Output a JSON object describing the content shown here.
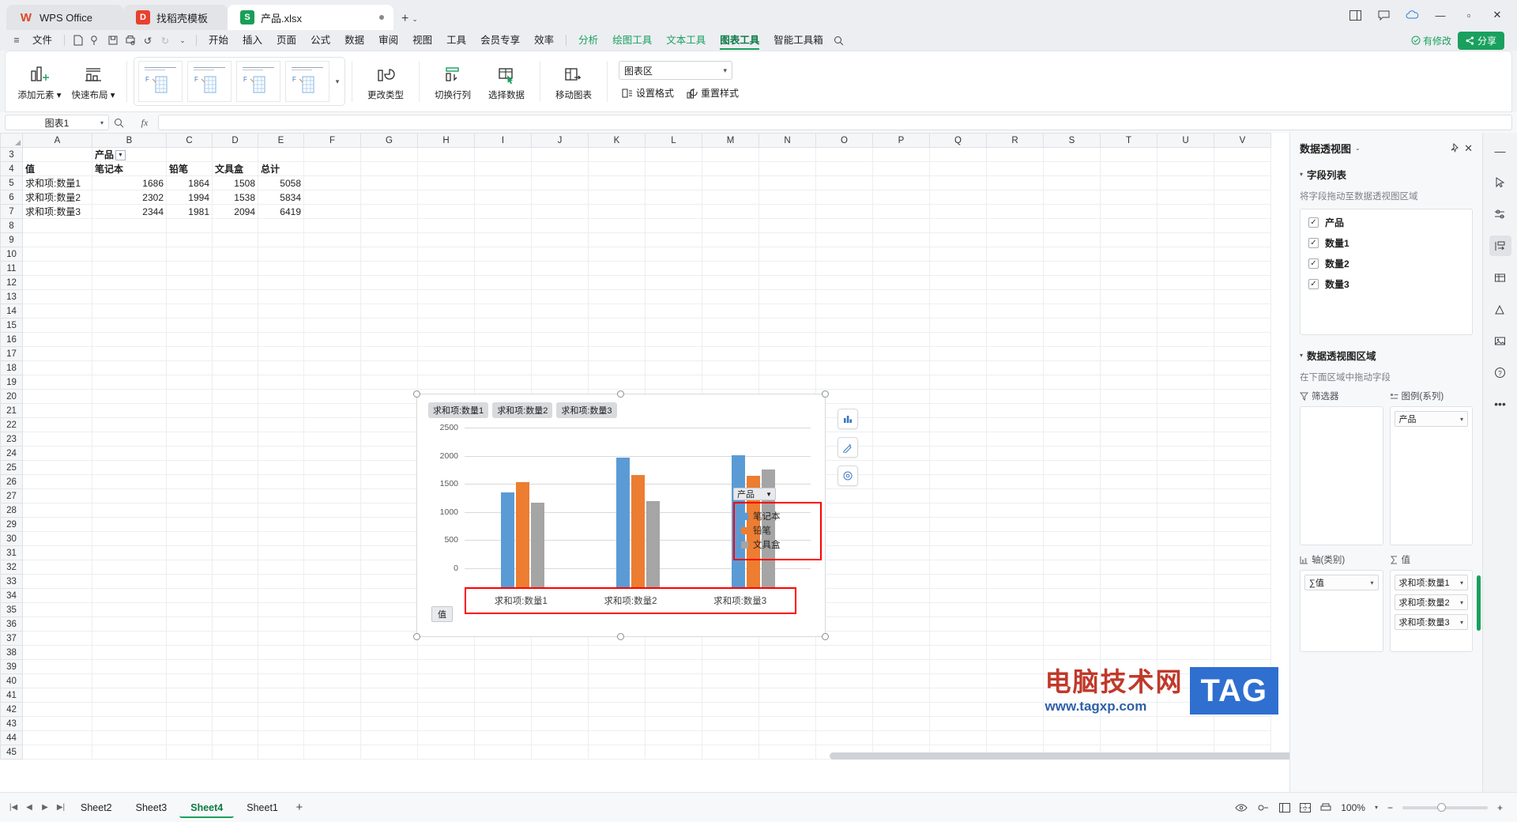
{
  "titlebar": {
    "tabs": [
      {
        "label": "WPS Office",
        "icon": "wps-logo-icon"
      },
      {
        "label": "找稻壳模板",
        "icon": "template-icon"
      },
      {
        "label": "产品.xlsx",
        "icon": "excel-file-icon"
      }
    ],
    "new_tab": "+",
    "new_tab_chevron": "⌄",
    "window_buttons": [
      "⊟",
      "🗗",
      "—",
      "▫",
      "✕"
    ]
  },
  "menubar": {
    "file_label": "文件",
    "items": [
      "开始",
      "插入",
      "页面",
      "公式",
      "数据",
      "审阅",
      "视图",
      "工具",
      "会员专享",
      "效率"
    ],
    "green_items": [
      "分析",
      "绘图工具",
      "文本工具"
    ],
    "active_item": "图表工具",
    "trailing_items": [
      "智能工具箱"
    ],
    "search_icon": "search-icon",
    "saved_label": "有修改",
    "share_label": "分享"
  },
  "ribbon": {
    "buttons": [
      {
        "label": "添加元素",
        "icon": "add-chart-element-icon",
        "dropdown": true
      },
      {
        "label": "快速布局",
        "icon": "quick-layout-icon",
        "dropdown": true
      }
    ],
    "gallery_more": "▾",
    "tools": [
      {
        "label": "更改类型",
        "icon": "change-chart-type-icon"
      },
      {
        "label": "切换行列",
        "icon": "switch-row-column-icon"
      },
      {
        "label": "选择数据",
        "icon": "select-data-icon"
      },
      {
        "label": "移动图表",
        "icon": "move-chart-icon"
      }
    ],
    "chart_area_select": "图表区",
    "format_label": "设置格式",
    "reset_label": "重置样式"
  },
  "formulabar": {
    "namebox": "图表1",
    "fx_label": "fx",
    "zoom_icon": "search-zoom-icon",
    "value": ""
  },
  "sheet": {
    "columns": [
      "A",
      "B",
      "C",
      "D",
      "E",
      "F",
      "G",
      "H",
      "I",
      "J",
      "K",
      "L",
      "M",
      "N",
      "O",
      "P",
      "Q",
      "R",
      "S",
      "T",
      "U",
      "V"
    ],
    "rows": [
      3,
      4,
      5,
      6,
      7,
      8,
      9,
      10,
      11,
      12,
      13,
      14,
      15,
      16,
      17,
      18,
      19,
      20,
      21,
      22,
      23,
      24,
      25,
      26,
      27,
      28,
      29,
      30,
      31,
      32,
      33,
      34,
      35,
      36,
      37,
      38,
      39,
      40,
      41,
      42,
      43,
      44,
      45
    ],
    "cells": {
      "B3": "产品",
      "A4": "值",
      "B4": "笔记本",
      "C4": "铅笔",
      "D4": "文具盒",
      "E4": "总计",
      "A5": "求和项:数量1",
      "B5": "1686",
      "C5": "1864",
      "D5": "1508",
      "E5": "5058",
      "A6": "求和项:数量2",
      "B6": "2302",
      "C6": "1994",
      "D6": "1538",
      "E6": "5834",
      "A7": "求和项:数量3",
      "B7": "2344",
      "C7": "1981",
      "D7": "2094",
      "E7": "6419"
    },
    "filter_glyph": "▼"
  },
  "chart_data": {
    "type": "bar",
    "title": "",
    "series_buttons": [
      "求和项:数量1",
      "求和项:数量2",
      "求和项:数量3"
    ],
    "categories": [
      "求和项:数量1",
      "求和项:数量2",
      "求和项:数量3"
    ],
    "series": [
      {
        "name": "笔记本",
        "color": "#5b9bd5",
        "values": [
          1686,
          2302,
          2344
        ]
      },
      {
        "name": "铅笔",
        "color": "#ed7d31",
        "values": [
          1864,
          1994,
          1981
        ]
      },
      {
        "name": "文具盒",
        "color": "#a5a5a5",
        "values": [
          1508,
          1538,
          2094
        ]
      }
    ],
    "yticks": [
      2500,
      2000,
      1500,
      1000,
      500,
      0
    ],
    "ylim": [
      0,
      2500
    ],
    "xlabel": "",
    "ylabel": "",
    "grid": true,
    "legend_position": "right",
    "legend_filter_label": "产品",
    "value_button": "值",
    "highlight_color": "#ff0000"
  },
  "chart_side_tools": [
    "chart-elements-icon",
    "chart-style-icon",
    "chart-filter-icon"
  ],
  "rightpanel": {
    "title": "数据透视图",
    "title_caret": "⌄",
    "pin_icon": "pin-icon",
    "close_icon": "close-icon",
    "field_section_title": "字段列表",
    "hint": "将字段拖动至数据透视图区域",
    "fields": [
      "产品",
      "数量1",
      "数量2",
      "数量3"
    ],
    "area_section_title": "数据透视图区域",
    "area_hint": "在下面区域中拖动字段",
    "zones": [
      {
        "title": "筛选器",
        "icon": "filter-icon",
        "chips": []
      },
      {
        "title": "图例(系列)",
        "icon": "legend-icon",
        "chips": [
          "产品"
        ]
      },
      {
        "title": "轴(类别)",
        "icon": "axis-icon",
        "chips": [
          "∑值"
        ]
      },
      {
        "title": "值",
        "icon": "sigma-icon",
        "chips": [
          "求和项:数量1",
          "求和项:数量2",
          "求和项:数量3"
        ]
      }
    ]
  },
  "rail_icons": [
    "cursor-icon",
    "settings-sliders-icon",
    "pivot-chart-icon",
    "table-icon",
    "shapes-icon",
    "image-icon",
    "help-icon",
    "more-icon"
  ],
  "sheetbar": {
    "nav": [
      "|◀",
      "◀",
      "▶",
      "▶|"
    ],
    "sheets": [
      "Sheet2",
      "Sheet3",
      "Sheet4",
      "Sheet1"
    ],
    "active_sheet": "Sheet4",
    "add_label": "+",
    "view_icons": [
      "eye-icon",
      "layout-icon",
      "page-icon",
      "grid-icon",
      "print-icon"
    ],
    "zoom_level": "100%",
    "zoom_minus": "−",
    "zoom_plus": "+"
  },
  "watermark": {
    "chinese": "电脑技术网",
    "url": "www.tagxp.com",
    "tag": "TAG"
  }
}
